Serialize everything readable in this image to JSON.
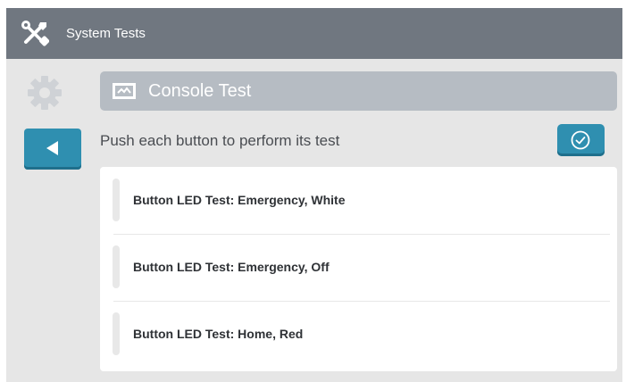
{
  "titlebar": {
    "title": "System Tests",
    "icon": "tools-icon"
  },
  "sidebar": {
    "gear_icon": "gear-icon",
    "back_icon": "back-arrow-icon"
  },
  "header": {
    "title": "Console Test",
    "icon": "console-icon"
  },
  "instruction": "Push each button to perform its test",
  "confirm": {
    "icon": "check-circle-icon"
  },
  "tests": [
    {
      "label": "Button LED Test: Emergency, White"
    },
    {
      "label": "Button LED Test: Emergency, Off"
    },
    {
      "label": "Button LED Test: Home, Red"
    }
  ],
  "colors": {
    "titlebar": "#707780",
    "accent": "#2f8fb0",
    "header_bar": "#b6bcc3",
    "background": "#e6e6e6"
  }
}
